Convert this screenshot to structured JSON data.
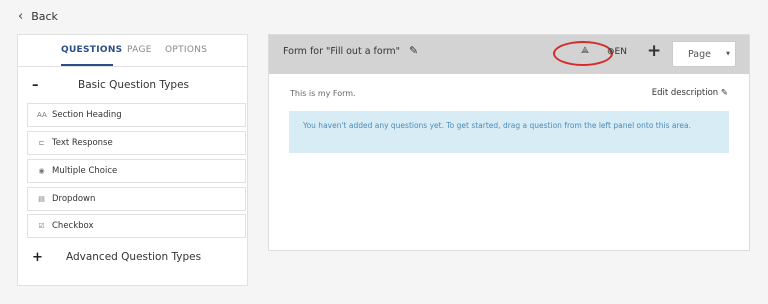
{
  "nav": {
    "back_label": "Back"
  },
  "left_panel": {
    "tabs": [
      {
        "label": "QUESTIONS",
        "active": true
      },
      {
        "label": "PAGE",
        "active": false
      },
      {
        "label": "OPTIONS",
        "active": false
      }
    ],
    "basic_section": {
      "toggle": "–",
      "label": "Basic Question Types"
    },
    "items": [
      {
        "icon": "AA",
        "icon_name": "section-heading-icon",
        "label": "Section Heading"
      },
      {
        "icon": "⊏",
        "icon_name": "text-response-icon",
        "label": "Text Response"
      },
      {
        "icon": "◉",
        "icon_name": "multiple-choice-icon",
        "label": "Multiple Choice"
      },
      {
        "icon": "▤",
        "icon_name": "dropdown-icon",
        "label": "Dropdown"
      },
      {
        "icon": "☑",
        "icon_name": "checkbox-icon",
        "label": "Checkbox"
      }
    ],
    "advanced_section": {
      "toggle": "+",
      "label": "Advanced Question Types"
    }
  },
  "form": {
    "title": "Form for \"Fill out a form\"",
    "language": "EN",
    "add_symbol": "+",
    "page_select": "Page",
    "description": "This is my Form.",
    "edit_description": "Edit description",
    "notice": "You haven't added any questions yet. To get started, drag a question from the left panel onto this area."
  },
  "colors": {
    "accent": "#2a4d86",
    "header_bg": "#d3d3d3",
    "notice_bg": "#d8ecf6",
    "notice_text": "#4c8bb8",
    "highlight": "#d52b2b"
  }
}
